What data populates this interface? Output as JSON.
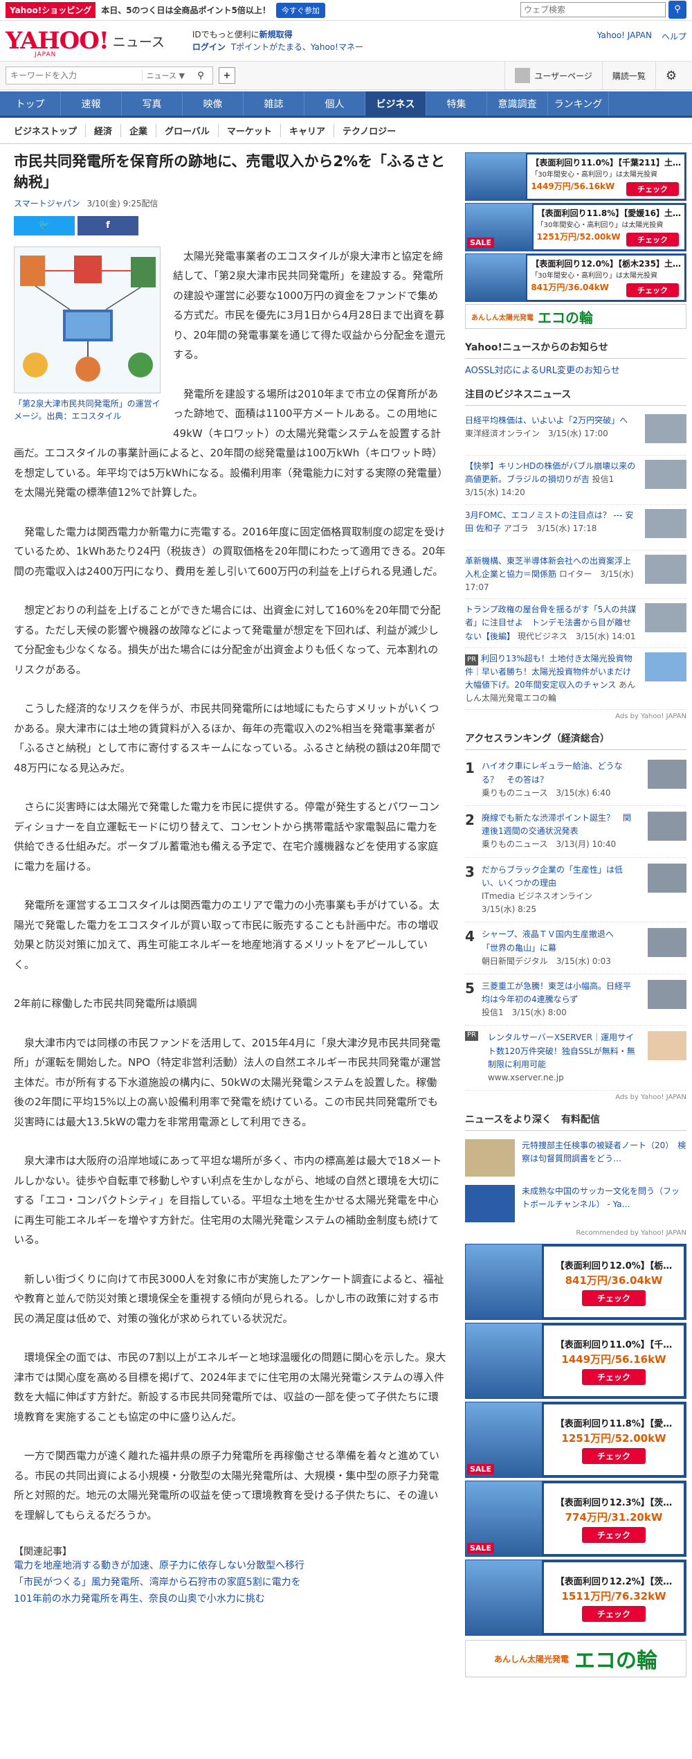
{
  "topbar": {
    "shopping": "Yahoo!ショッピング",
    "promo": "本日、5のつく日は全商品ポイント5倍以上！",
    "promo_btn": "今すぐ参加",
    "web_search_placeholder": "ウェブ検索"
  },
  "header": {
    "logo": "YAHOO!",
    "logo_sub": "JAPAN",
    "news": "ニュース",
    "id_text": "IDでもっと便利に",
    "signup": "新規取得",
    "login": "ログイン",
    "tpoint": "Tポイントがたまる、Yahoo!マネー",
    "yahoo_japan": "Yahoo! JAPAN",
    "help": "ヘルプ"
  },
  "search": {
    "placeholder": "キーワードを入力",
    "scope": "ニュース ▼",
    "user_page": "ユーザーページ",
    "subscriptions": "購読一覧"
  },
  "gnav": [
    "トップ",
    "速報",
    "写真",
    "映像",
    "雑誌",
    "個人",
    "ビジネス",
    "特集",
    "意識調査",
    "ランキング"
  ],
  "subnav": [
    "ビジネストップ",
    "経済",
    "企業",
    "グローバル",
    "マーケット",
    "キャリア",
    "テクノロジー"
  ],
  "article": {
    "headline": "市民共同発電所を保育所の跡地に、売電収入から2%を「ふるさと納税」",
    "source": "スマートジャパン",
    "date": "3/10(金) 9:25配信",
    "caption": "「第2泉大津市民共同発電所」の運営イメージ。出典：エコスタイル",
    "paragraphs": [
      "太陽光発電事業者のエコスタイルが泉大津市と協定を締結して、「第2泉大津市民共同発電所」を建設する。発電所の建設や運営に必要な1000万円の資金をファンドで集める方式だ。市民を優先に3月1日から4月28日まで出資を募り、20年間の発電事業を通じて得た収益から分配金を還元する。",
      "発電所を建設する場所は2010年まで市立の保育所があった跡地で、面積は1100平方メートルある。この用地に49kW（キロワット）の太陽光発電システムを設置する計画だ。エコスタイルの事業計画によると、20年間の総発電量は100万kWh（キロワット時）を想定している。年平均では5万kWhになる。設備利用率（発電能力に対する実際の発電量）を太陽光発電の標準値12%で計算した。",
      "発電した電力は関西電力か新電力に売電する。2016年度に固定価格買取制度の認定を受けているため、1kWhあたり24円（税抜き）の買取価格を20年間にわたって適用できる。20年間の売電収入は2400万円になり、費用を差し引いて600万円の利益を上げられる見通しだ。",
      "想定どおりの利益を上げることができた場合には、出資金に対して160%を20年間で分配する。ただし天候の影響や機器の故障などによって発電量が想定を下回れば、利益が減少して分配金も少なくなる。損失が出た場合には分配金が出資金よりも低くなって、元本割れのリスクがある。",
      "こうした経済的なリスクを伴うが、市民共同発電所には地域にもたらすメリットがいくつかある。泉大津市には土地の賃貸料が入るほか、毎年の売電収入の2%相当を発電事業者が「ふるさと納税」として市に寄付するスキームになっている。ふるさと納税の額は20年間で48万円になる見込みだ。",
      "さらに災害時には太陽光で発電した電力を市民に提供する。停電が発生するとパワーコンディショナーを自立運転モードに切り替えて、コンセントから携帯電話や家電製品に電力を供給できる仕組みだ。ポータブル蓄電池も備える予定で、在宅介護機器などを使用する家庭に電力を届ける。",
      "発電所を運営するエコスタイルは関西電力のエリアで電力の小売事業も手がけている。太陽光で発電した電力をエコスタイルが買い取って市民に販売することも計画中だ。市の増収効果と防災対策に加えて、再生可能エネルギーを地産地消するメリットをアピールしていく。"
    ],
    "subhead": "2年前に稼働した市民共同発電所は順調",
    "paragraphs2": [
      "泉大津市内では同様の市民ファンドを活用して、2015年4月に「泉大津汐見市民共同発電所」が運転を開始した。NPO（特定非営利活動）法人の自然エネルギー市民共同発電が運営主体だ。市が所有する下水道施設の構内に、50kWの太陽光発電システムを設置した。稼働後の2年間に平均15%以上の高い設備利用率で発電を続けている。この市民共同発電所でも災害時には最大13.5kWの電力を非常用電源として利用できる。",
      "泉大津市は大阪府の沿岸地域にあって平坦な場所が多く、市内の標高差は最大で18メートルしかない。徒歩や自転車で移動しやすい利点を生かしながら、地域の自然と環境を大切にする「エコ・コンパクトシティ」を目指している。平坦な土地を生かせる太陽光発電を中心に再生可能エネルギーを増やす方針だ。住宅用の太陽光発電システムの補助金制度も続けている。",
      "新しい街づくりに向けて市民3000人を対象に市が実施したアンケート調査によると、福祉や教育と並んで防災対策と環境保全を重視する傾向が見られる。しかし市の政策に対する市民の満足度は低めで、対策の強化が求められている状況だ。",
      "環境保全の面では、市民の7割以上がエネルギーと地球温暖化の問題に関心を示した。泉大津市では関心度を高める目標を掲げて、2024年までに住宅用の太陽光発電システムの導入件数を大幅に伸ばす方針だ。新設する市民共同発電所では、収益の一部を使って子供たちに環境教育を実施することも協定の中に盛り込んだ。",
      "一方で関西電力が遠く離れた福井県の原子力発電所を再稼働させる準備を着々と進めている。市民の共同出資による小規模・分散型の太陽光発電所は、大規模・集中型の原子力発電所と対照的だ。地元の太陽光発電所の収益を使って環境教育を受ける子供たちに、その違いを理解してもらえるだろうか。"
    ],
    "related_head": "【関連記事】",
    "related": [
      "電力を地産地消する動きが加速、原子力に依存しない分散型へ移行",
      "「市民がつくる」風力発電所、湾岸から石狩市の家庭5割に電力を",
      "101年前の水力発電所を再生、奈良の山奥で小水力に挑む"
    ]
  },
  "sidebar": {
    "ads_top": [
      {
        "title": "【表面利回り11.0%】【千葉211】土…",
        "desc": "「30年間安心・高利回り」は太陽光投資",
        "price": "1449万円/56.16kW",
        "check": "チェック",
        "sale": ""
      },
      {
        "title": "【表面利回り11.8%】【愛媛16】土…",
        "desc": "「30年間安心・高利回り」は太陽光投資",
        "price": "1251万円/52.00kW",
        "check": "チェック",
        "sale": "SALE"
      },
      {
        "title": "【表面利回り12.0%】【栃木235】土…",
        "desc": "「30年間安心・高利回り」は太陽光投資",
        "price": "841万円/36.04kW",
        "check": "チェック",
        "sale": ""
      }
    ],
    "eco_banner": "エコの輪",
    "eco_sub": "あんしん太陽光発電",
    "notice_title": "Yahoo!ニュースからのお知らせ",
    "notice_link": "AOSSL対応によるURL変更のお知らせ",
    "biz_title": "注目のビジネスニュース",
    "biz_items": [
      {
        "title": "日経平均株価は、いよいよ「2万円突破」へ",
        "src": "東洋経済オンライン　3/15(水) 17:00"
      },
      {
        "title": "【快挙】キリンHDの株価がバブル崩壊以来の高値更新。ブラジルの損切りが吉",
        "src": "投信1　3/15(水) 14:20"
      },
      {
        "title": "3月FOMC、エコノミストの注目点は？ --- 安田 佐和子",
        "src": "アゴラ　3/15(水) 17:18"
      },
      {
        "title": "革新機構、東芝半導体新会社への出資案浮上　入札企業と協力＝関係筋",
        "src": "ロイター　3/15(水) 17:07"
      },
      {
        "title": "トランプ政権の屋台骨を揺るがす「5人の共謀者」に注目せよ　トンデモ法書から目が離せない【後編】",
        "src": "現代ビジネス　3/15(水) 14:01"
      }
    ],
    "biz_pr": {
      "badge": "PR",
      "title": "利回り13%超も！土地付き太陽光投資物件｜早い者勝ち！太陽光投資物件がいまだけ大幅値下げ。20年間安定収入のチャンス",
      "src": "あんしん太陽光発電エコの輪"
    },
    "ads_by": "Ads by Yahoo! JAPAN",
    "rank_title": "アクセスランキング（経済総合）",
    "ranking": [
      {
        "num": "1",
        "title": "ハイオク車にレギュラー給油、どうなる？　その答は？",
        "src": "乗りものニュース　3/15(水) 6:40"
      },
      {
        "title": "廃線でも新たな渋滞ポイント誕生？　関連後1週間の交通状況発表",
        "src": "乗りものニュース　3/13(月) 10:40",
        "num": "2"
      },
      {
        "num": "3",
        "title": "だからブラック企業の「生産性」は低い、いくつかの理由",
        "src": "ITmedia ビジネスオンライン　3/15(水) 8:25"
      },
      {
        "num": "4",
        "title": "シャープ、液晶ＴＶ国内生産撤退へ　「世界の亀山」に幕",
        "src": "朝日新聞デジタル　3/15(水) 0:03"
      },
      {
        "num": "5",
        "title": "三菱重工が急騰！東芝は小幅高。日経平均は今年初の4連騰ならず",
        "src": "投信1　3/15(水) 8:00"
      }
    ],
    "rank_pr": {
      "badge": "PR",
      "title": "レンタルサーバーXSERVER｜運用サイト数120万件突破！独自SSLが無料・無制限に利用可能",
      "src": "www.xserver.ne.jp"
    },
    "deep_title": "ニュースをより深く　有料配信",
    "deep_items": [
      "元特捜部主任検事の被疑者ノート（20）　検察は句督質問調書をどう…",
      "未成熟な中国のサッカー文化を問う（フットボールチャンネル） - Ya…"
    ],
    "recommended": "Recommended by Yahoo! JAPAN",
    "ads_bottom": [
      {
        "title": "【表面利回り12.0%】【栃…",
        "price": "841万円/36.04kW",
        "btn": "チェック",
        "sale": ""
      },
      {
        "title": "【表面利回り11.0%】【千…",
        "price": "1449万円/56.16kW",
        "btn": "チェック",
        "sale": ""
      },
      {
        "title": "【表面利回り11.8%】【愛…",
        "price": "1251万円/52.00kW",
        "btn": "チェック",
        "sale": "SALE"
      },
      {
        "title": "【表面利回り12.3%】【茨…",
        "price": "774万円/31.20kW",
        "btn": "チェック",
        "sale": "SALE"
      },
      {
        "title": "【表面利回り12.2%】【茨…",
        "price": "1511万円/76.32kW",
        "btn": "チェック",
        "sale": ""
      }
    ]
  }
}
